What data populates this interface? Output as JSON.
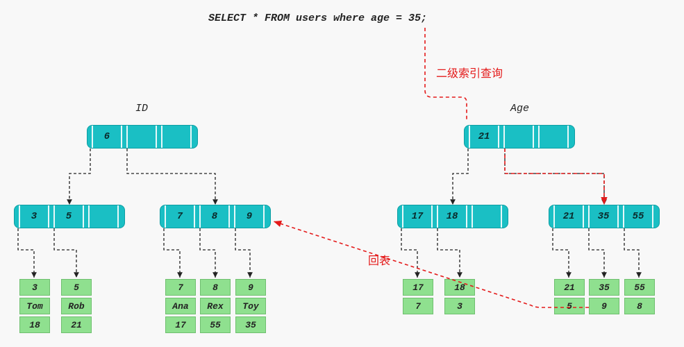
{
  "sql": "SELECT * FROM users where age = 35;",
  "annotations": {
    "secondary_index": "二级索引查询",
    "back_to_table": "回表"
  },
  "left_tree": {
    "label": "ID",
    "root": {
      "keys": [
        "6"
      ]
    },
    "inner": [
      {
        "keys": [
          "3",
          "5"
        ]
      },
      {
        "keys": [
          "7",
          "8",
          "9"
        ]
      }
    ],
    "leaves": [
      {
        "id": "3",
        "name": "Tom",
        "val": "18"
      },
      {
        "id": "5",
        "name": "Rob",
        "val": "21"
      },
      {
        "id": "7",
        "name": "Ana",
        "val": "17"
      },
      {
        "id": "8",
        "name": "Rex",
        "val": "55"
      },
      {
        "id": "9",
        "name": "Toy",
        "val": "35"
      }
    ]
  },
  "right_tree": {
    "label": "Age",
    "root": {
      "keys": [
        "21"
      ]
    },
    "inner": [
      {
        "keys": [
          "17",
          "18"
        ]
      },
      {
        "keys": [
          "21",
          "35",
          "55"
        ]
      }
    ],
    "leaves": [
      {
        "age": "17",
        "id": "7"
      },
      {
        "age": "18",
        "id": "3"
      },
      {
        "age": "21",
        "id": "5"
      },
      {
        "age": "35",
        "id": "9"
      },
      {
        "age": "55",
        "id": "8"
      }
    ]
  },
  "watermark": ""
}
